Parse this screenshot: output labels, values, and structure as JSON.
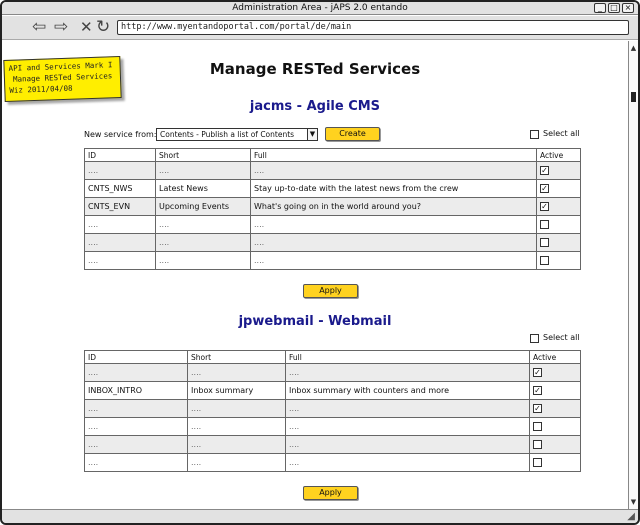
{
  "window": {
    "title": "Administration Area - jAPS 2.0 entando"
  },
  "navbar": {
    "url": "http://www.myentandoportal.com/portal/de/main"
  },
  "sticky": {
    "line1": "API and Services Mark I",
    "line2": "Manage RESTed Services",
    "line3": "Wiz 2011/04/08"
  },
  "page": {
    "title": "Manage RESTed Services"
  },
  "section1": {
    "title": "jacms - Agile CMS",
    "new_service_label": "New service from:",
    "select_value": "Contents - Publish a list of Contents",
    "create_label": "Create",
    "select_all_label": "Select all",
    "headers": [
      "ID",
      "Short",
      "Full",
      "Active"
    ],
    "rows": [
      {
        "id": "....",
        "short": "....",
        "full": "....",
        "active": true
      },
      {
        "id": "CNTS_NWS",
        "short": "Latest News",
        "full": "Stay up-to-date with the latest news from the crew",
        "active": true
      },
      {
        "id": "CNTS_EVN",
        "short": "Upcoming Events",
        "full": "What's going on in the world around you?",
        "active": true
      },
      {
        "id": "....",
        "short": "....",
        "full": "....",
        "active": false
      },
      {
        "id": "....",
        "short": "....",
        "full": "....",
        "active": false
      },
      {
        "id": "....",
        "short": "....",
        "full": "....",
        "active": false
      }
    ],
    "apply_label": "Apply"
  },
  "section2": {
    "title": "jpwebmail - Webmail",
    "select_all_label": "Select all",
    "headers": [
      "ID",
      "Short",
      "Full",
      "Active"
    ],
    "rows": [
      {
        "id": "....",
        "short": "....",
        "full": "....",
        "active": true
      },
      {
        "id": "INBOX_INTRO",
        "short": "Inbox summary",
        "full": "Inbox summary with counters and more",
        "active": true
      },
      {
        "id": "....",
        "short": "....",
        "full": "....",
        "active": true
      },
      {
        "id": "....",
        "short": "....",
        "full": "....",
        "active": false
      },
      {
        "id": "....",
        "short": "....",
        "full": "....",
        "active": false
      },
      {
        "id": "....",
        "short": "....",
        "full": "....",
        "active": false
      }
    ],
    "apply_label": "Apply"
  }
}
